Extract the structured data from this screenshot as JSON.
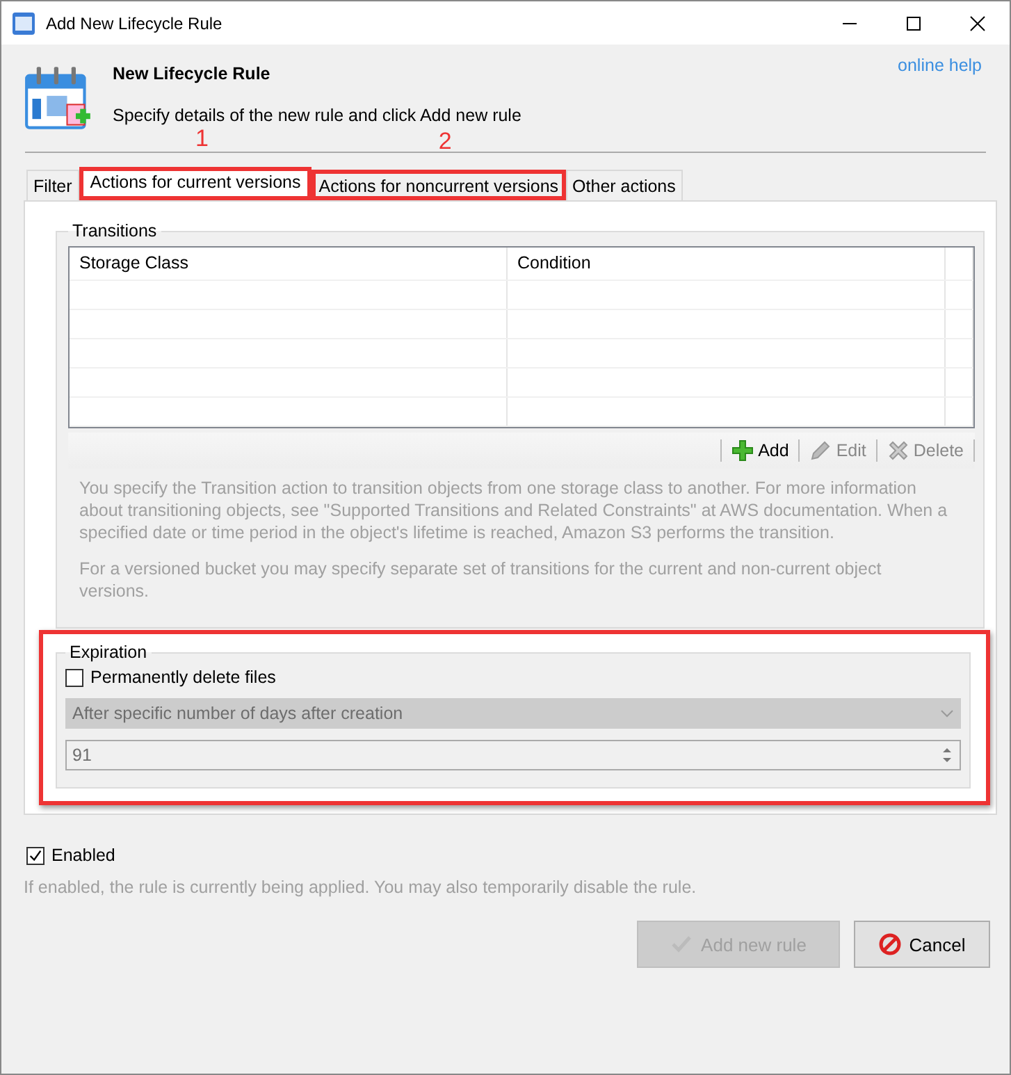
{
  "window": {
    "title": "Add New Lifecycle Rule"
  },
  "header": {
    "title": "New Lifecycle Rule",
    "subtitle": "Specify details of the new rule and click Add new rule",
    "help_link": "online help"
  },
  "tabs": [
    {
      "label": "Filter",
      "selected": false
    },
    {
      "label": "Actions for current versions",
      "selected": true,
      "annotation": "1"
    },
    {
      "label": "Actions for noncurrent versions",
      "selected": false,
      "annotation": "2"
    },
    {
      "label": "Other actions",
      "selected": false
    }
  ],
  "transitions": {
    "title": "Transitions",
    "columns": [
      "Storage Class",
      "Condition"
    ],
    "toolbar": [
      {
        "label": "Add",
        "kind": "add",
        "disabled": false
      },
      {
        "label": "Edit",
        "kind": "edit",
        "disabled": true
      },
      {
        "label": "Delete",
        "kind": "delete",
        "disabled": true
      }
    ],
    "description": [
      "You specify the Transition action to transition objects from one storage class to another. For more information about transitioning objects, see \"Supported Transitions and Related Constraints\" at AWS documentation. When a specified date or time period in the object's lifetime is reached, Amazon S3 performs the transition.",
      "For a versioned bucket you may specify separate set of transitions for the current and non-current object versions."
    ]
  },
  "expiration": {
    "title": "Expiration",
    "highlighted": true,
    "checkbox": {
      "label": "Permanently delete files",
      "checked": false
    },
    "dropdown": {
      "value": "After specific number of days after creation",
      "disabled": true
    },
    "days": {
      "value": "91",
      "disabled": true
    }
  },
  "enabled": {
    "label": "Enabled",
    "checked": true
  },
  "hint": "If enabled, the rule is currently being applied. You may also temporarily disable the rule.",
  "buttons": [
    {
      "label": "Add new rule",
      "kind": "ok",
      "disabled": true
    },
    {
      "label": "Cancel",
      "kind": "cancel",
      "disabled": false
    }
  ]
}
